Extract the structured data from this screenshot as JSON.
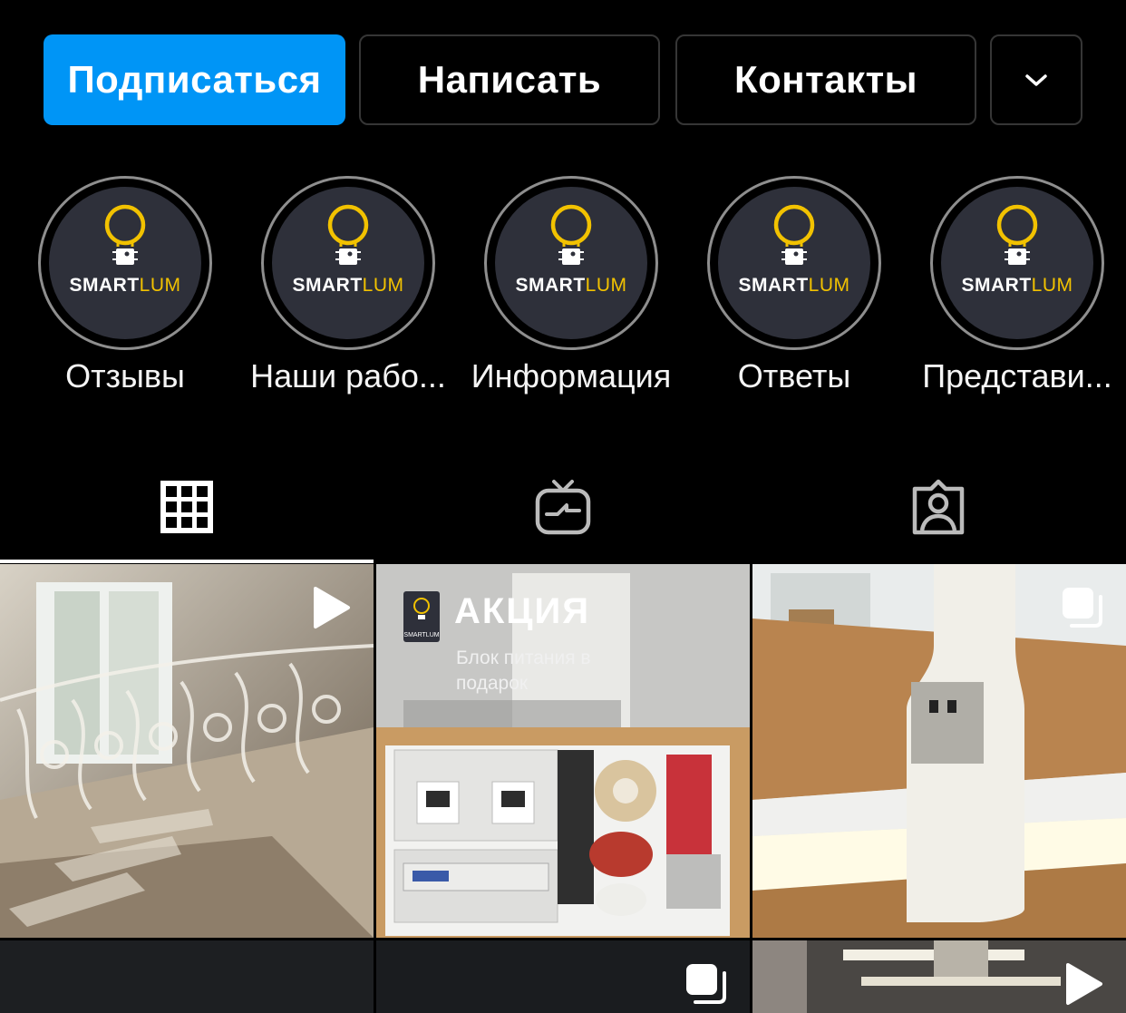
{
  "actions": {
    "follow_label": "Подписаться",
    "message_label": "Написать",
    "contacts_label": "Контакты",
    "more_icon": "chevron-down-icon"
  },
  "highlights": [
    {
      "label": "Отзывы",
      "logo_text_a": "SMART",
      "logo_text_b": "LUM"
    },
    {
      "label": "Наши рабо...",
      "logo_text_a": "SMART",
      "logo_text_b": "LUM"
    },
    {
      "label": "Информация",
      "logo_text_a": "SMART",
      "logo_text_b": "LUM"
    },
    {
      "label": "Ответы",
      "logo_text_a": "SMART",
      "logo_text_b": "LUM"
    },
    {
      "label": "Представи...",
      "logo_text_a": "SMART",
      "logo_text_b": "LUM"
    }
  ],
  "tabs": [
    {
      "icon": "grid-icon",
      "active": true
    },
    {
      "icon": "igtv-icon",
      "active": false
    },
    {
      "icon": "tagged-icon",
      "active": false
    }
  ],
  "posts": [
    {
      "type": "video",
      "badge_icon": "play-icon"
    },
    {
      "type": "image",
      "title": "АКЦИЯ",
      "subtitle": "Блок питания в подарок",
      "logo_text": "SMARTLUM"
    },
    {
      "type": "carousel",
      "badge_icon": "carousel-icon"
    },
    {
      "type": "image"
    },
    {
      "type": "carousel",
      "badge_icon": "carousel-icon"
    },
    {
      "type": "video",
      "badge_icon": "play-icon"
    }
  ],
  "colors": {
    "primary": "#0095f6",
    "background": "#000000",
    "border": "#363636",
    "logo_yellow": "#f2c200",
    "logo_bg": "#2e303a"
  }
}
